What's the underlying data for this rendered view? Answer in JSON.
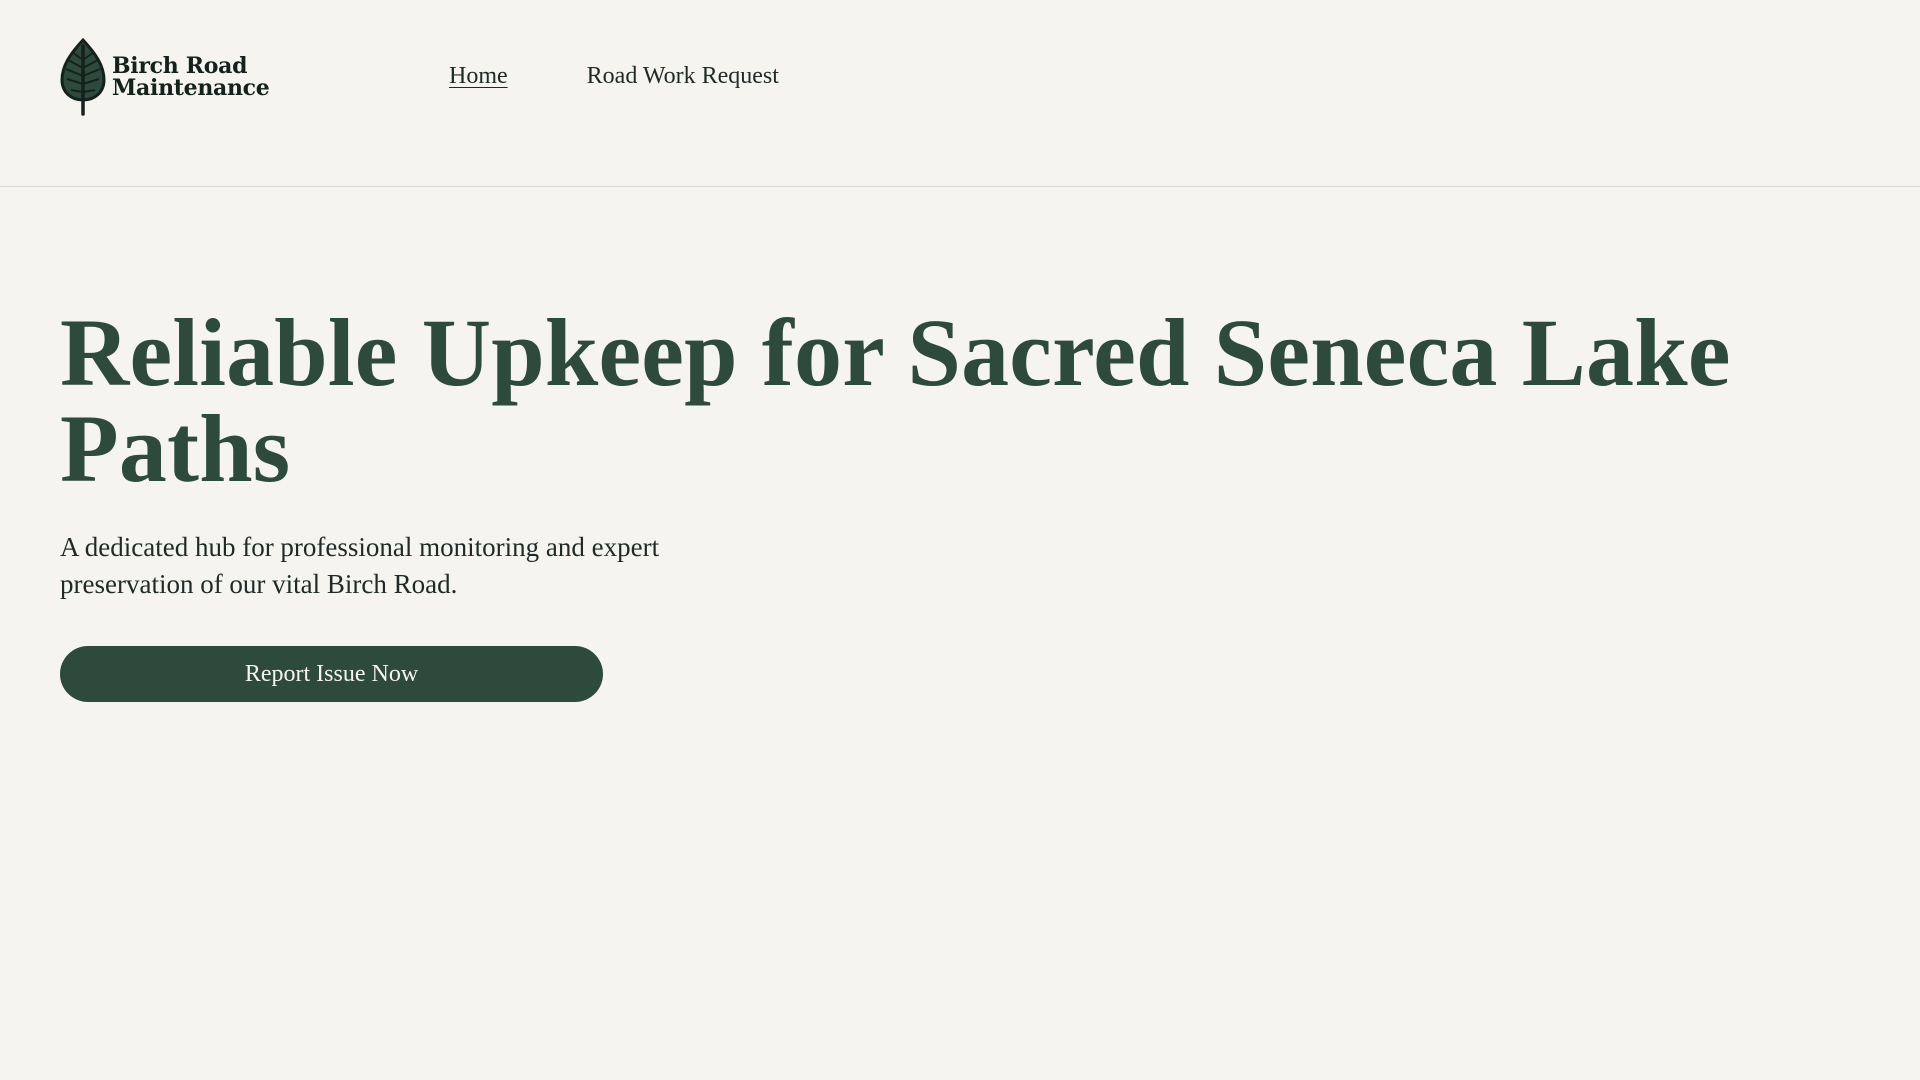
{
  "header": {
    "brand": {
      "line1": "Birch Road",
      "line2": "Maintenance",
      "icon": "leaf-icon"
    },
    "nav": [
      {
        "label": "Home",
        "active": true
      },
      {
        "label": "Road Work Request",
        "active": false
      }
    ]
  },
  "hero": {
    "title": "Reliable Upkeep for Sacred Seneca Lake Paths",
    "subtitle": "A dedicated hub for professional monitoring and expert preservation of our vital Birch Road.",
    "cta_label": "Report Issue Now"
  },
  "colors": {
    "background": "#f5f4ef",
    "accent": "#2e4a3c",
    "text": "#1f2a26"
  }
}
